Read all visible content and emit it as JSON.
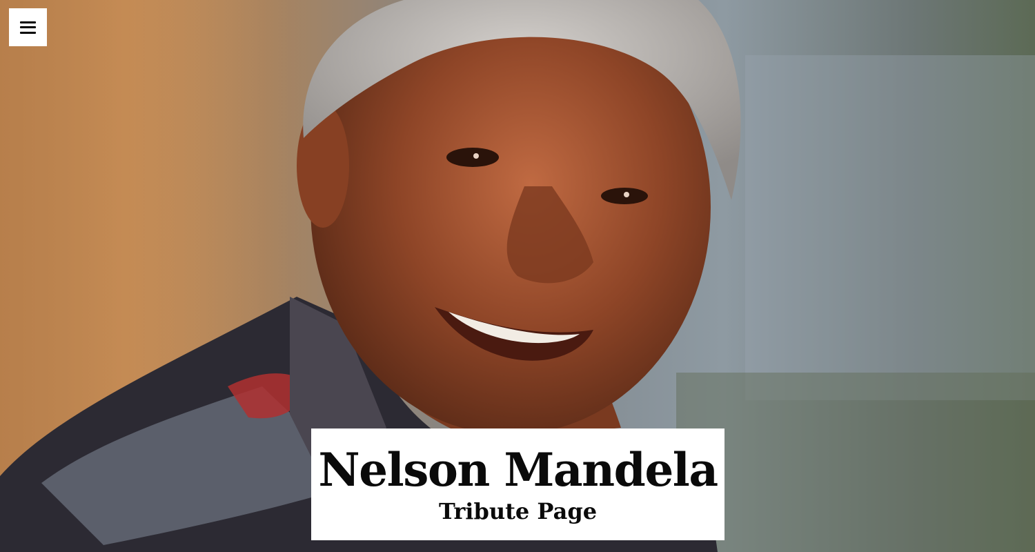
{
  "hero": {
    "image": "portrait-photo",
    "title": "Nelson Mandela",
    "subtitle": "Tribute Page"
  },
  "nav": {
    "menu_icon": "hamburger-menu-icon"
  },
  "colors": {
    "title_box_bg": "#ffffff",
    "title_text": "#0a0a0a",
    "menu_button_bg": "#ffffff"
  }
}
